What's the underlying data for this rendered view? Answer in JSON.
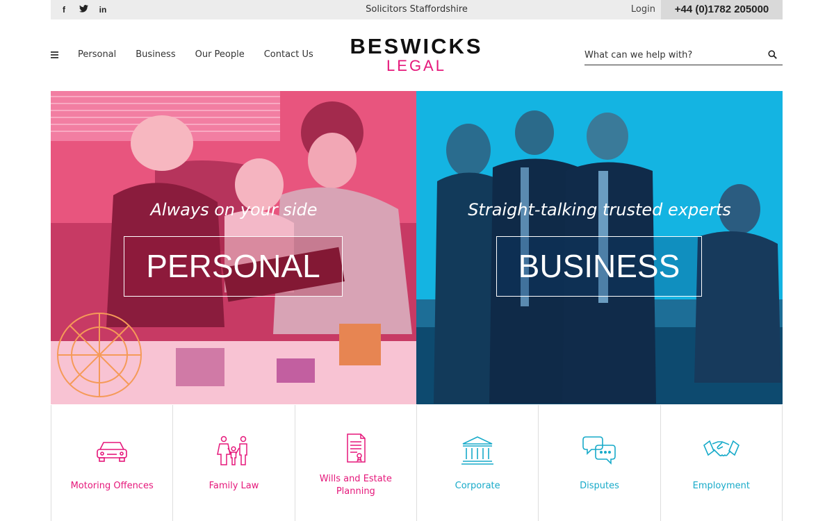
{
  "topbar": {
    "social": [
      {
        "name": "facebook",
        "glyph": "f"
      },
      {
        "name": "twitter",
        "glyph": "🐦"
      },
      {
        "name": "linkedin",
        "glyph": "in"
      }
    ],
    "tagline": "Solicitors Staffordshire",
    "login": "Login",
    "phone": "+44 (0)1782 205000"
  },
  "nav": {
    "items": [
      "Personal",
      "Business",
      "Our People",
      "Contact Us"
    ]
  },
  "logo": {
    "line1": "BESWICKS",
    "line2": "LEGAL"
  },
  "search": {
    "placeholder": "What can we help with?"
  },
  "hero": {
    "personal": {
      "tagline": "Always on your side",
      "button": "PERSONAL"
    },
    "business": {
      "tagline": "Straight-talking trusted experts",
      "button": "BUSINESS"
    }
  },
  "services": [
    {
      "label": "Motoring Offences",
      "icon": "car-icon",
      "theme": "pink"
    },
    {
      "label": "Family Law",
      "icon": "family-icon",
      "theme": "pink"
    },
    {
      "label": "Wills and Estate Planning",
      "icon": "document-icon",
      "theme": "pink"
    },
    {
      "label": "Corporate",
      "icon": "bank-icon",
      "theme": "blue"
    },
    {
      "label": "Disputes",
      "icon": "speech-bubbles-icon",
      "theme": "blue"
    },
    {
      "label": "Employment",
      "icon": "handshake-icon",
      "theme": "blue"
    }
  ],
  "colors": {
    "brand_pink": "#e5177a",
    "brand_blue": "#17aac9",
    "hero_pink": "#e8557e",
    "hero_blue": "#14b4e2"
  }
}
